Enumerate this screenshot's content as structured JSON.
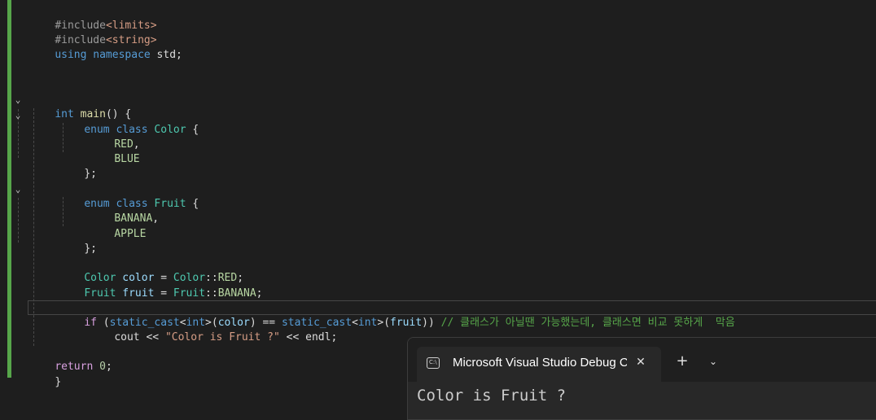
{
  "editor": {
    "lines": {
      "include_limits": {
        "directive": "#include",
        "header": "<limits>"
      },
      "include_string": {
        "directive": "#include",
        "header": "<string>"
      },
      "using": {
        "kw1": "using",
        "kw2": "namespace",
        "rest": " std;"
      },
      "main_sig": {
        "type": "int",
        "name": "main",
        "rest": "() {"
      },
      "enum_color": {
        "kw1": "enum",
        "kw2": "class",
        "name": "Color",
        "rest": " {"
      },
      "red": {
        "value": "RED",
        "punct": ","
      },
      "blue": {
        "value": "BLUE"
      },
      "close1": {
        "text": "};"
      },
      "enum_fruit": {
        "kw1": "enum",
        "kw2": "class",
        "name": "Fruit",
        "rest": " {"
      },
      "banana": {
        "value": "BANANA",
        "punct": ","
      },
      "apple": {
        "value": "APPLE"
      },
      "close2": {
        "text": "};"
      },
      "color_decl": {
        "type": "Color",
        "var": "color",
        "eq": " = ",
        "scope": "Color",
        "sep": "::",
        "value": "RED",
        "end": ";"
      },
      "fruit_decl": {
        "type": "Fruit",
        "var": "fruit",
        "eq": " = ",
        "scope": "Fruit",
        "sep": "::",
        "value": "BANANA",
        "end": ";"
      },
      "if_line": {
        "kw": "if",
        "open": " (",
        "cast1": "static_cast",
        "lt1": "<",
        "int1": "int",
        "gt1": ">(",
        "arg1": "color",
        "op": ") == ",
        "cast2": "static_cast",
        "lt2": "<",
        "int2": "int",
        "gt2": ">(",
        "arg2": "fruit",
        "close": ")) ",
        "comment": "// 클래스가 아닐땐 가능했는데, 클래스면 비교 못하게  막음"
      },
      "cout_line": {
        "cout": "cout",
        "op1": " << ",
        "str": "\"Color is Fruit ?\"",
        "op2": " << ",
        "endl": "endl",
        "end": ";"
      },
      "return_line": {
        "kw": "return",
        "sp": " ",
        "num": "0",
        "end": ";"
      },
      "main_close": {
        "text": "}"
      }
    },
    "fold_glyph": "⌄"
  },
  "terminal": {
    "tab_title": "Microsoft Visual Studio Debug Console",
    "tab_icon": "C:\\",
    "close_glyph": "✕",
    "new_tab_glyph": "+",
    "dropdown_glyph": "⌄",
    "output": "Color is Fruit ?"
  }
}
